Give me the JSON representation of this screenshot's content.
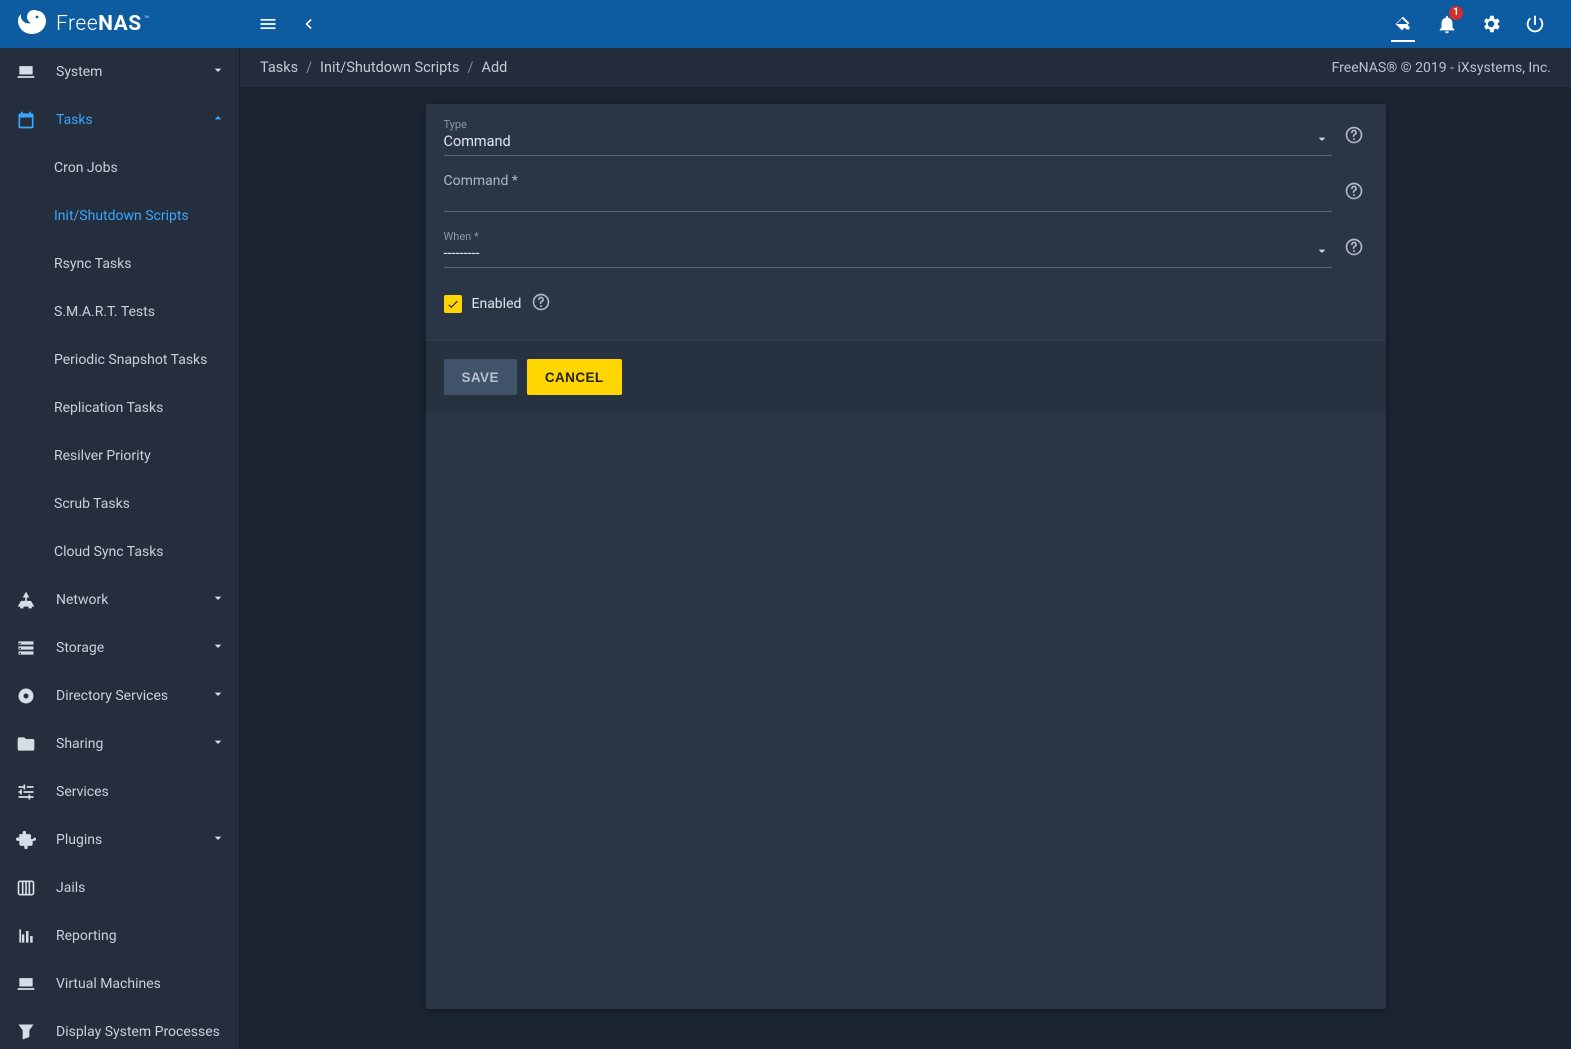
{
  "brand": {
    "name_a": "Free",
    "name_b": "NAS",
    "tm": "™"
  },
  "topbar": {
    "badge": "1"
  },
  "breadcrumb": {
    "a": "Tasks",
    "b": "Init/Shutdown Scripts",
    "c": "Add"
  },
  "copyright": "FreeNAS® © 2019 - iXsystems, Inc.",
  "sidebar": {
    "system": "System",
    "tasks": "Tasks",
    "tasks_children": {
      "cron": "Cron Jobs",
      "init": "Init/Shutdown Scripts",
      "rsync": "Rsync Tasks",
      "smart": "S.M.A.R.T. Tests",
      "snapshot": "Periodic Snapshot Tasks",
      "replication": "Replication Tasks",
      "resilver": "Resilver Priority",
      "scrub": "Scrub Tasks",
      "cloud": "Cloud Sync Tasks"
    },
    "network": "Network",
    "storage": "Storage",
    "directory": "Directory Services",
    "sharing": "Sharing",
    "services": "Services",
    "plugins": "Plugins",
    "jails": "Jails",
    "reporting": "Reporting",
    "vms": "Virtual Machines",
    "dsp": "Display System Processes"
  },
  "form": {
    "type_label": "Type",
    "type_value": "Command",
    "command_label": "Command *",
    "command_value": "",
    "when_label": "When *",
    "when_value": "---------",
    "enabled_label": "Enabled",
    "enabled_checked": true,
    "save": "SAVE",
    "cancel": "CANCEL"
  }
}
